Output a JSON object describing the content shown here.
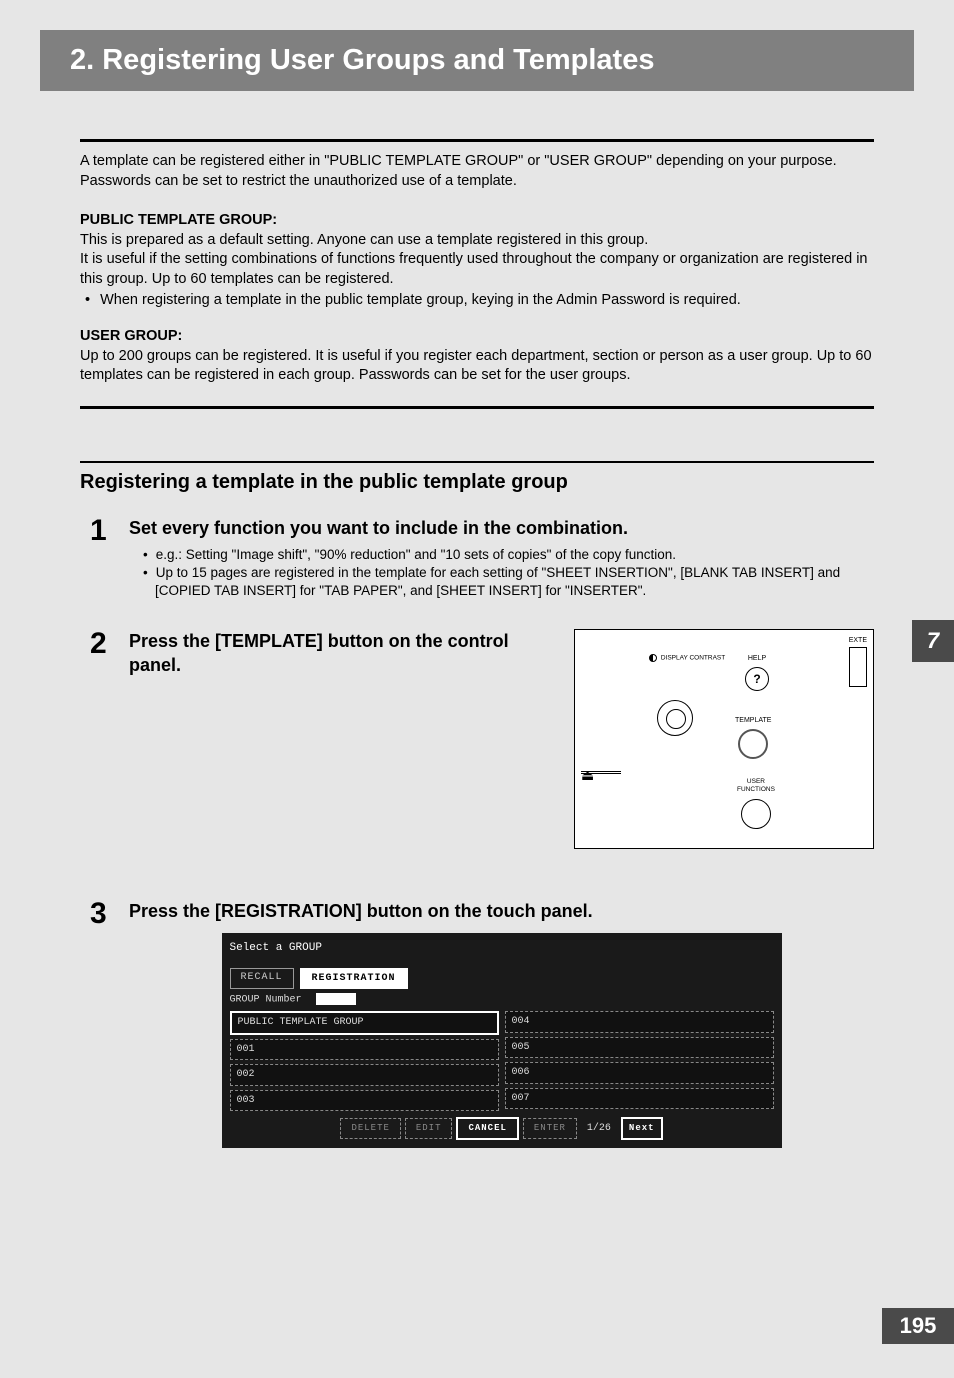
{
  "title": "2. Registering User Groups and Templates",
  "intro": "A template can be registered either in \"PUBLIC TEMPLATE GROUP\" or \"USER GROUP\" depending on your purpose. Passwords can be set to restrict the unauthorized use of a template.",
  "public_heading": "PUBLIC TEMPLATE GROUP:",
  "public_p1": "This is prepared as a default setting. Anyone can use a template registered in this group.",
  "public_p2": "It is useful if the setting combinations of functions frequently used throughout the company or organization are registered in this group. Up to 60 templates can be registered.",
  "public_bullet": "When registering a template in the public template group, keying in the Admin Password is required.",
  "user_heading": "USER GROUP:",
  "user_p": "Up to 200 groups can be registered. It is useful if you register each department, section or person as a user group. Up to 60 templates can be registered in each group. Passwords can be set for the user groups.",
  "section_title": "Registering a template in the public template group",
  "step1": {
    "num": "1",
    "title": "Set every function you want to include in the combination.",
    "b1": "e.g.: Setting \"Image shift\", \"90% reduction\" and \"10 sets of copies\" of the copy function.",
    "b2": "Up to 15 pages are registered in the template for each setting of \"SHEET INSERTION\", [BLANK TAB INSERT] and [COPIED TAB INSERT] for \"TAB PAPER\", and [SHEET INSERT] for \"INSERTER\"."
  },
  "step2": {
    "num": "2",
    "title": "Press the [TEMPLATE] button on the control panel."
  },
  "step3": {
    "num": "3",
    "title": "Press the [REGISTRATION] button on the touch panel."
  },
  "panel": {
    "display_contrast": "DISPLAY CONTRAST",
    "help": "HELP",
    "help_q": "?",
    "template": "TEMPLATE",
    "user_functions": "USER\nFUNCTIONS",
    "exte": "EXTE"
  },
  "touch": {
    "header": "Select a GROUP",
    "recall": "RECALL",
    "registration": "REGISTRATION",
    "group_number": "GROUP Number",
    "left": [
      "PUBLIC TEMPLATE GROUP",
      "001",
      "002",
      "003"
    ],
    "right": [
      "004",
      "005",
      "006",
      "007"
    ],
    "buttons": {
      "delete": "DELETE",
      "edit": "EDIT",
      "cancel": "CANCEL",
      "enter": "ENTER",
      "next": "Next"
    },
    "page": "1/26"
  },
  "side_tab": "7",
  "page_number": "195"
}
